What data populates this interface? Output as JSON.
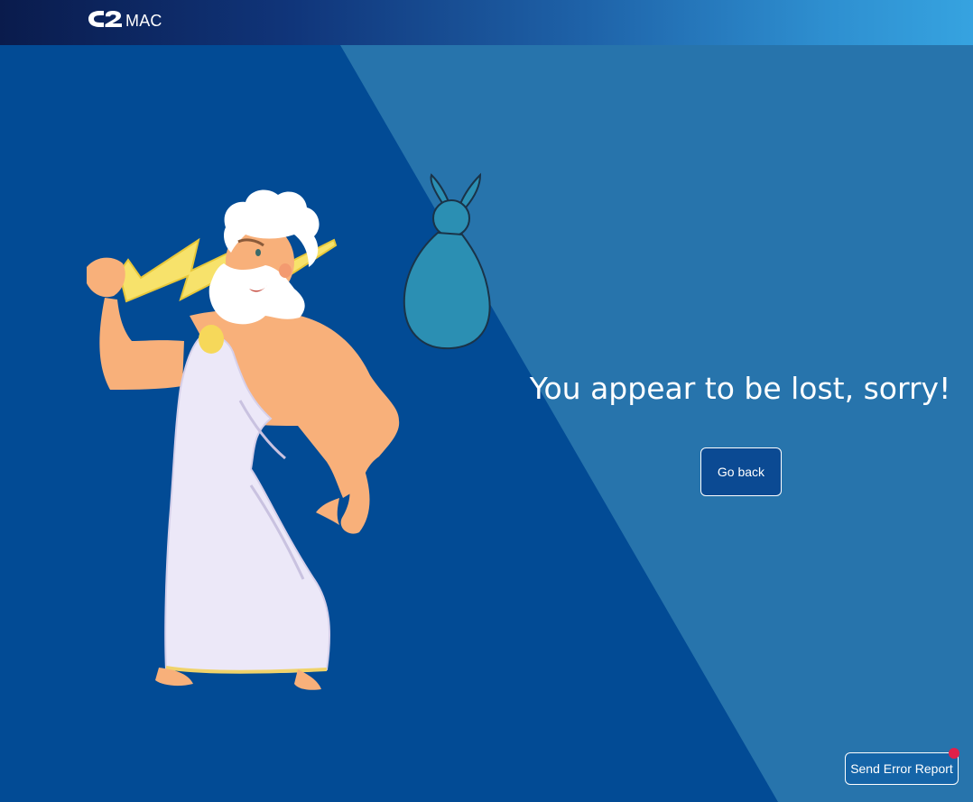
{
  "header": {
    "logo_mark": "C2",
    "logo_text": "MAC"
  },
  "main": {
    "headline": "You appear to be lost, sorry!",
    "go_back_label": "Go back"
  },
  "footer": {
    "send_error_report_label": "Send Error Report"
  },
  "colors": {
    "dark_panel": "#024b95",
    "light_panel": "#2774ac",
    "notification": "#e0204a"
  }
}
